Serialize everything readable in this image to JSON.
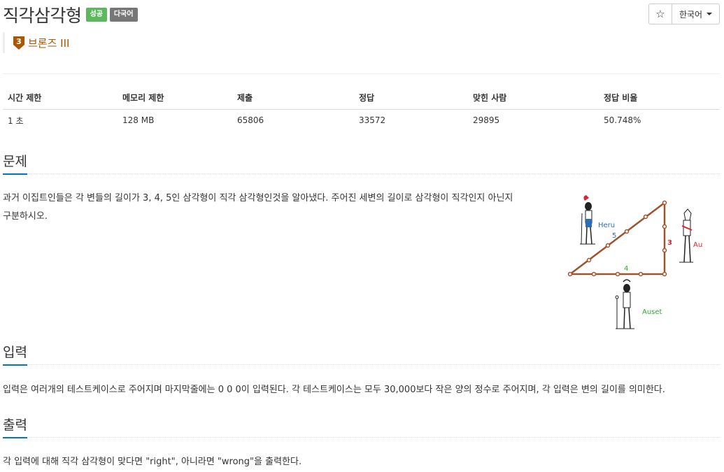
{
  "problem": {
    "title": "직각삼각형",
    "badges": {
      "success": "성공",
      "multilang": "다국어"
    },
    "tier": {
      "number": "3",
      "label": "브론즈 III"
    }
  },
  "controls": {
    "star": "☆",
    "language": "한국어"
  },
  "info_table": {
    "headers": [
      "시간 제한",
      "메모리 제한",
      "제출",
      "정답",
      "맞힌 사람",
      "정답 비율"
    ],
    "values": [
      "1 초",
      "128 MB",
      "65806",
      "33572",
      "29895",
      "50.748%"
    ]
  },
  "sections": {
    "problem": {
      "heading": "문제",
      "text_line1": "과거 이집트인들은 각 변들의 길이가 3, 4, 5인 삼각형이 직각 삼각형인것을 알아냈다. 주어진 세변의 길이로 삼각형이 직각인지 아닌지",
      "text_line2": "구분하시오."
    },
    "input": {
      "heading": "입력",
      "text": "입력은 여러개의 테스트케이스로 주어지며 마지막줄에는 0 0 0이 입력된다. 각 테스트케이스는 모두 30,000보다 작은 양의 정수로 주어지며, 각 입력은 변의 길이를 의미한다."
    },
    "output": {
      "heading": "출력",
      "text": "각 입력에 대해 직각 삼각형이 맞다면 \"right\", 아니라면 \"wrong\"을 출력한다."
    }
  },
  "figure": {
    "labels": {
      "heru": "Heru",
      "ausar": "Ausar",
      "auset": "Auset",
      "side5": "5",
      "side3": "3",
      "side4": "4"
    },
    "colors": {
      "rope": "#a0522d",
      "heru": "#2a6ebb",
      "ausar": "#d9232d",
      "auset": "#3aa335"
    }
  }
}
